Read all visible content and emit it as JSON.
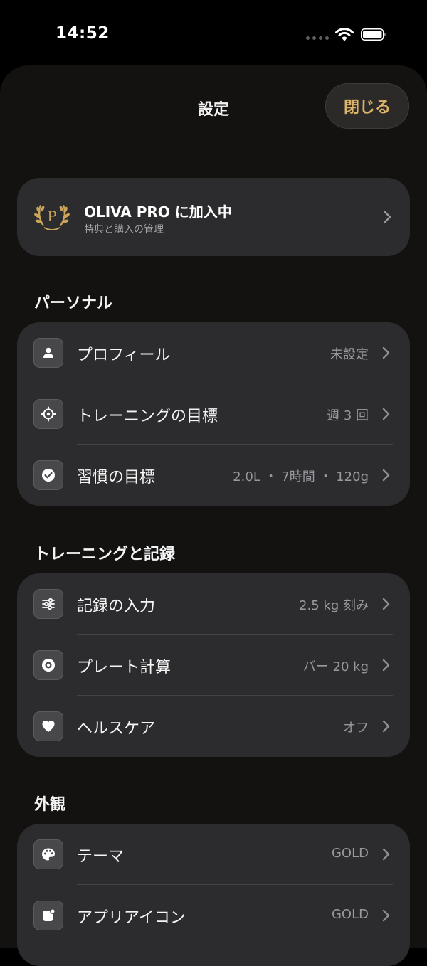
{
  "status": {
    "time": "14:52"
  },
  "header": {
    "title": "設定",
    "close_label": "閉じる"
  },
  "pro": {
    "title": "OLIVA PRO に加入中",
    "subtitle": "特典と購入の管理",
    "badge_letter": "P"
  },
  "sections": [
    {
      "title": "パーソナル",
      "rows": [
        {
          "label": "プロフィール",
          "value": "未設定",
          "icon": "person-icon"
        },
        {
          "label": "トレーニングの目標",
          "value": "週 3 回",
          "icon": "target-icon"
        },
        {
          "label": "習慣の目標",
          "value": "2.0L ・ 7時間 ・ 120g",
          "icon": "checkmark-circle-icon"
        }
      ]
    },
    {
      "title": "トレーニングと記録",
      "rows": [
        {
          "label": "記録の入力",
          "value": "2.5 kg 刻み",
          "icon": "sliders-icon"
        },
        {
          "label": "プレート計算",
          "value": "バー 20 kg",
          "icon": "weight-plate-icon"
        },
        {
          "label": "ヘルスケア",
          "value": "オフ",
          "icon": "heart-icon"
        }
      ]
    },
    {
      "title": "外観",
      "rows": [
        {
          "label": "テーマ",
          "value": "GOLD",
          "icon": "palette-icon"
        },
        {
          "label": "アプリアイコン",
          "value": "GOLD",
          "icon": "app-icon"
        }
      ]
    }
  ],
  "colors": {
    "accent": "#dcb367",
    "background": "#131211",
    "card": "#2c2c2e"
  }
}
